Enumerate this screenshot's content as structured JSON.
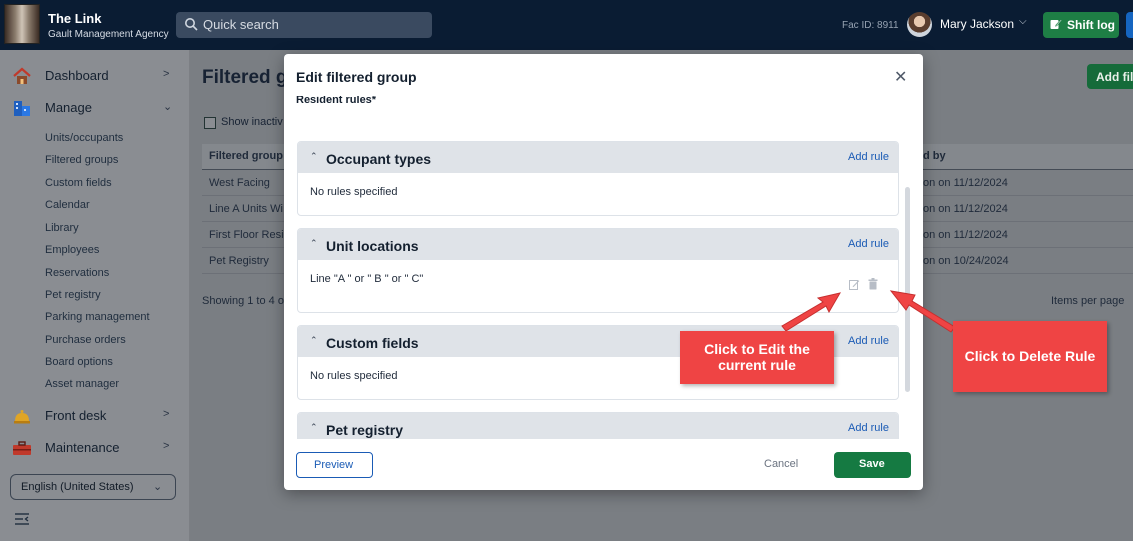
{
  "topbar": {
    "title": "The Link",
    "subtitle": "Gault Management Agency",
    "search_placeholder": "Quick search",
    "fac_id": "Fac ID: 8911",
    "user_name": "Mary Jackson",
    "shift_log": "Shift log"
  },
  "sidebar": {
    "dashboard": "Dashboard",
    "manage": "Manage",
    "sub_items": [
      "Units/occupants",
      "Filtered groups",
      "Custom fields",
      "Calendar",
      "Library",
      "Employees",
      "Reservations",
      "Pet registry",
      "Parking management",
      "Purchase orders",
      "Board options",
      "Asset manager"
    ],
    "front_desk": "Front desk",
    "maintenance": "Maintenance",
    "language": "English (United States)"
  },
  "page": {
    "title": "Filtered g",
    "add_button": "Add filt",
    "show_inactive": "Show inactiv",
    "col_group": "Filtered group n",
    "col_modified": "d by",
    "rows": [
      {
        "name": "West Facing",
        "modified": "on on 11/12/2024"
      },
      {
        "name": "Line A Units Wi",
        "modified": "on on 11/12/2024"
      },
      {
        "name": "First Floor Resi",
        "modified": "on on 11/12/2024"
      },
      {
        "name": "Pet Registry",
        "modified": "on on 10/24/2024"
      }
    ],
    "showing": "Showing 1 to 4 o",
    "items_per_page": "Items per page"
  },
  "modal": {
    "title": "Edit filtered group",
    "resident_rules": "Resident rules*",
    "add_rule": "Add rule",
    "sections": [
      {
        "name": "Occupant types",
        "body": "No rules specified"
      },
      {
        "name": "Unit locations",
        "body": "Line \"A \" or \" B \" or \" C\""
      },
      {
        "name": "Custom fields",
        "body": "No rules specified"
      },
      {
        "name": "Pet registry",
        "body": ""
      }
    ],
    "preview": "Preview",
    "cancel": "Cancel",
    "save": "Save"
  },
  "callouts": {
    "edit_line1": "Click to Edit the",
    "edit_line2": "current rule",
    "delete": "Click to Delete Rule"
  },
  "colors": {
    "topbar": "#0a1c33",
    "accent_green": "#157a42",
    "link_blue": "#1a5bb5",
    "callout_red": "#ef4444"
  }
}
